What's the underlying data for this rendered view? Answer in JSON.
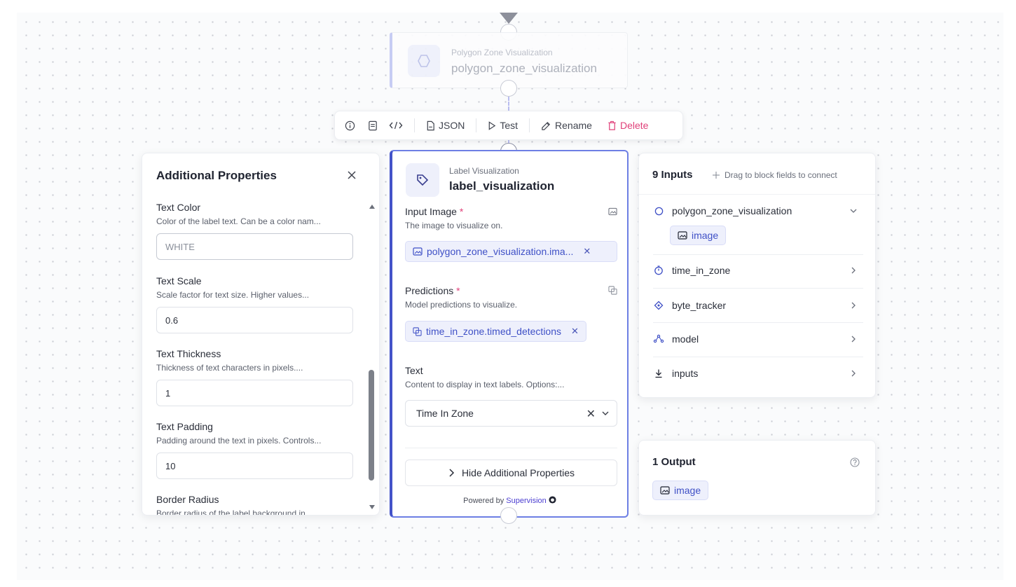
{
  "upstream_node": {
    "type_label": "Polygon Zone Visualization",
    "name": "polygon_zone_visualization"
  },
  "toolbar": {
    "json_label": "JSON",
    "test_label": "Test",
    "rename_label": "Rename",
    "delete_label": "Delete",
    "colors": {
      "delete": "#e0417a"
    }
  },
  "additional_properties": {
    "title": "Additional Properties",
    "fields": [
      {
        "label": "Text Color",
        "description": "Color of the label text. Can be a color nam...",
        "value": "WHITE"
      },
      {
        "label": "Text Scale",
        "description": "Scale factor for text size. Higher values...",
        "value": "0.6"
      },
      {
        "label": "Text Thickness",
        "description": "Thickness of text characters in pixels....",
        "value": "1"
      },
      {
        "label": "Text Padding",
        "description": "Padding around the text in pixels. Controls...",
        "value": "10"
      },
      {
        "label": "Border Radius",
        "description": "Border radius of the label background in..."
      }
    ]
  },
  "block": {
    "type_label": "Label Visualization",
    "name": "label_visualization",
    "accent_color": "#4353c9",
    "input_image": {
      "label": "Input Image",
      "required_mark": "*",
      "description": "The image to visualize on.",
      "binding": "polygon_zone_visualization.ima..."
    },
    "predictions": {
      "label": "Predictions",
      "required_mark": "*",
      "description": "Model predictions to visualize.",
      "binding": "time_in_zone.timed_detections"
    },
    "text": {
      "label": "Text",
      "description": "Content to display in text labels. Options:...",
      "selected": "Time In Zone"
    },
    "hide_button": "Hide Additional Properties",
    "powered_by": "Powered by",
    "powered_brand": "Supervision"
  },
  "inputs_panel": {
    "title": "9 Inputs",
    "hint": "Drag to block fields to connect",
    "items": [
      {
        "name": "polygon_zone_visualization",
        "icon": "circle-outline-icon",
        "expanded": true,
        "chip": "image"
      },
      {
        "name": "time_in_zone",
        "icon": "timer-icon"
      },
      {
        "name": "byte_tracker",
        "icon": "crosshair-icon"
      },
      {
        "name": "model",
        "icon": "model-icon"
      },
      {
        "name": "inputs",
        "icon": "download-icon"
      }
    ]
  },
  "outputs_panel": {
    "title": "1 Output",
    "items": [
      {
        "name": "image"
      }
    ]
  }
}
